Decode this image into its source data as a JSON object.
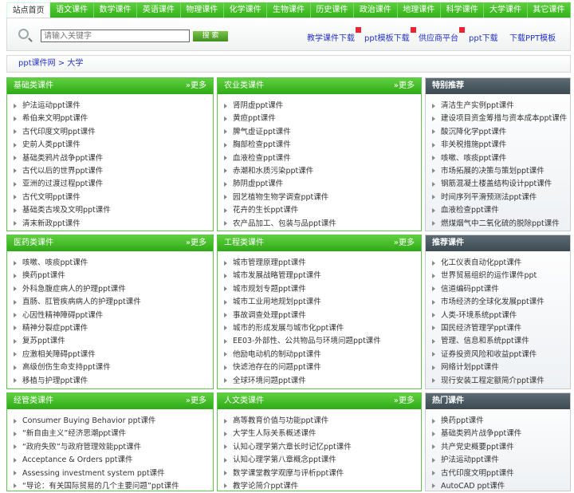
{
  "nav": [
    "站点首页",
    "语文课件",
    "数学课件",
    "英语课件",
    "物理课件",
    "化学课件",
    "生物课件",
    "历史课件",
    "政治课件",
    "地理课件",
    "科学课件",
    "大学课件",
    "其它课件"
  ],
  "search": {
    "placeholder": "请输入关键字",
    "button": "搜 索"
  },
  "header_links": [
    "教学课件下载",
    "ppt模板下载",
    "供应商平台",
    "ppt下载",
    "下载PPT模板"
  ],
  "breadcrumb": "ppt课件网 > 大学",
  "more_label": "»更多",
  "panels": [
    {
      "title": "基础类课件",
      "style": "green",
      "items": [
        "护法运动ppt课件",
        "希伯来文明ppt课件",
        "古代印度文明ppt课件",
        "史前人类ppt课件",
        "基础类鸦片战争ppt课件",
        "古代以后的世界ppt课件",
        "亚洲的过渡过程ppt课件",
        "古代文明ppt课件",
        "基础类古埃及文明ppt课件",
        "清末新政ppt课件"
      ]
    },
    {
      "title": "农业类课件",
      "style": "green",
      "items": [
        "肾阴虚ppt课件",
        "黄疸ppt课件",
        "脾气虚证ppt课件",
        "胸部检查ppt课件",
        "血液检查ppt课件",
        "赤潮和水质污染ppt课件",
        "肺阴虚ppt课件",
        "园艺植物生物学调查ppt课件",
        "花卉的生长ppt课件",
        "农产品加工、包装与品ppt课件"
      ]
    },
    {
      "title": "特别推荐",
      "style": "gray",
      "items": [
        "清洁生产实例ppt课件",
        "建设项目资金筹措与资本成本ppt课件",
        "酸沉降化学ppt课件",
        "非关税措施ppt课件",
        "咳嗽、咳痰ppt课件",
        "市场拓展的决策与策划ppt课件",
        "钢筋混凝土楼盖结构设计ppt课件",
        "时间序列平滑预测法ppt课件",
        "血液检查ppt课件",
        "燃煤烟气中二氧化硫的脱除ppt课件"
      ]
    },
    {
      "title": "医药类课件",
      "style": "green",
      "items": [
        "咳嗽、咳痰ppt课件",
        "换药ppt课件",
        "外科急腹症病人的护理ppt课件",
        "直肠、肛管疾病病人的护理ppt课件",
        "心因性精神障碍ppt课件",
        "精神分裂症ppt课件",
        "复苏ppt课件",
        "应激相关障碍ppt课件",
        "高级创伤生命支持ppt课件",
        "移植与护理ppt课件"
      ]
    },
    {
      "title": "工程类课件",
      "style": "green",
      "items": [
        "城市管理原理ppt课件",
        "城市发展战略管理ppt课件",
        "城市规划专题ppt课件",
        "城市工业用地规划ppt课件",
        "事故调查处理ppt课件",
        "城市的形成发展与城市化ppt课件",
        "EE03-外部性、公共物品与环境问题ppt课件",
        "他励电动机的制动ppt课件",
        "快滤池存在的问题ppt课件",
        "全球环境问题ppt课件"
      ]
    },
    {
      "title": "推荐课件",
      "style": "gray",
      "items": [
        "化工仪表自动化ppt课件",
        "世界贸易组织的运作课件ppt",
        "信道编码ppt课件",
        "市场经济的全球化发展ppt课件",
        "人类-环境系统ppt课件",
        "国民经济管理学ppt课件",
        "管理、信息和系统ppt课件",
        "证券投资风险和收益ppt课件",
        "网络计划ppt课件",
        "现行安装工程定额简介ppt课件"
      ]
    },
    {
      "title": "经管类课件",
      "style": "green",
      "items": [
        "Consumer Buying Behavior ppt课件",
        "“新自由主义”经济思潮ppt课件",
        "“政府失败”与政府管理效能ppt课件",
        "Acceptance & Orders ppt课件",
        "Assessing investment system ppt课件",
        "“导论：有关国际贸易的几个主要问题”ppt课件"
      ]
    },
    {
      "title": "人文类课件",
      "style": "green",
      "items": [
        "高等教育价值与功能ppt课件",
        "大学生人际关系概述课件",
        "认知心理学第六章长时记忆ppt课件",
        "认知心理学第八章概念ppt课件",
        "数学课堂教学观摩与评析ppt课件",
        "教学论简介ppt课件"
      ]
    },
    {
      "title": "热门课件",
      "style": "gray",
      "items": [
        "换药ppt课件",
        "基础类鸦片战争ppt课件",
        "共产党史概要ppt课件",
        "护法运动ppt课件",
        "古代印度文明ppt课件",
        "AutoCAD ppt课件"
      ]
    }
  ]
}
